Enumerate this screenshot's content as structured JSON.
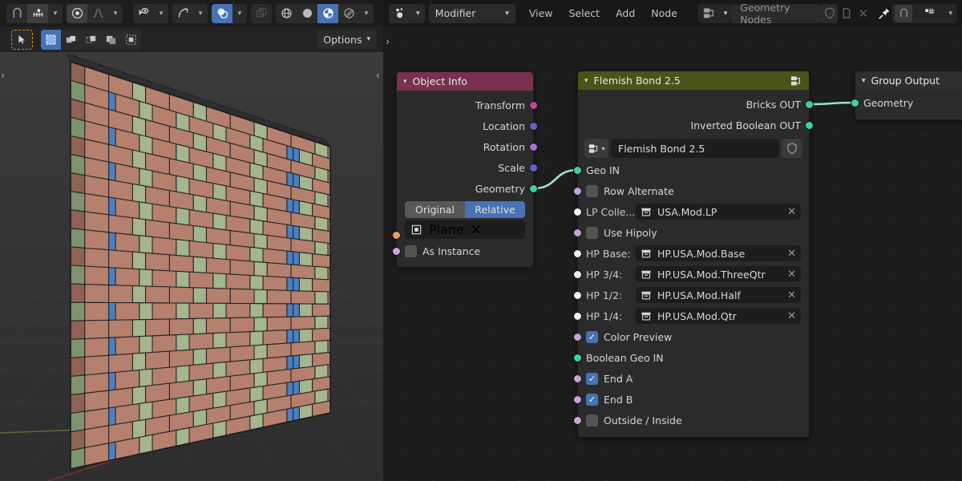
{
  "viewport": {
    "toolbar_row1": [
      {
        "name": "snap-magnet-icon",
        "state": "off"
      },
      {
        "name": "snap-increment-icon",
        "state": "off"
      },
      {
        "name": "snap-dropdown-chevron",
        "state": "off"
      },
      {
        "name": "proportional-edit-icon",
        "state": "on"
      },
      {
        "name": "proportional-falloff-icon",
        "state": "dim"
      },
      {
        "name": "falloff-dropdown-chevron",
        "state": "off"
      },
      {
        "name": "visibility-eye-icon",
        "state": "off"
      },
      {
        "name": "visibility-dropdown-chevron",
        "state": "off"
      },
      {
        "name": "gizmo-icon",
        "state": "off"
      },
      {
        "name": "gizmo-dropdown-chevron",
        "state": "dim"
      },
      {
        "name": "overlays-icon",
        "state": "active"
      },
      {
        "name": "overlays-dropdown-chevron",
        "state": "off"
      },
      {
        "name": "xray-toggle-icon",
        "state": "dim"
      },
      {
        "name": "shading-wireframe-icon",
        "state": "off"
      },
      {
        "name": "shading-solid-icon",
        "state": "off"
      },
      {
        "name": "shading-material-icon",
        "state": "active"
      },
      {
        "name": "shading-rendered-icon",
        "state": "off"
      },
      {
        "name": "shading-dropdown-chevron",
        "state": "off"
      }
    ],
    "select_modes": [
      "tweak",
      "box",
      "circle",
      "lasso"
    ],
    "options_label": "Options",
    "expand_arrow_left": "<",
    "expand_arrow_region": ">"
  },
  "node_editor": {
    "header": {
      "editor_type_icon": "geometry-nodes-editor-icon",
      "mode_select": "Modifier",
      "menus": [
        "View",
        "Select",
        "Add",
        "Node"
      ],
      "datablock_icon": "node-group-icon",
      "datablock_name": "Geometry Nodes",
      "shield_icon": "fake-user-shield-icon",
      "duplicate_icon": "new-copy-icon",
      "unlink_icon": "unlink-x-icon",
      "pin_icon": "pin-icon",
      "snap_icon": "snap-magnet-icon",
      "snap_target_icon": "snap-grid-icon",
      "snap_chevron": "chevron-down-icon"
    },
    "nodes": [
      {
        "id": "object-info",
        "title": "Object Info",
        "header_color": "#7a3050",
        "outputs": [
          {
            "label": "Transform",
            "color": "#c4478f"
          },
          {
            "label": "Location",
            "color": "#6363c7"
          },
          {
            "label": "Rotation",
            "color": "#a86fd4"
          },
          {
            "label": "Scale",
            "color": "#6363c7"
          },
          {
            "label": "Geometry",
            "color": "#3ed2a0"
          }
        ],
        "transform_space": {
          "options": [
            "Original",
            "Relative"
          ],
          "selected": "Relative"
        },
        "object_field": {
          "icon": "object-plane-icon",
          "value": "Plane",
          "clear": "✕",
          "socket_color": "#ed9e5c"
        },
        "as_instance": {
          "label": "As Instance",
          "checked": false,
          "socket_color": "#c7a2dd"
        }
      },
      {
        "id": "flemish-bond",
        "title": "Flemish Bond 2.5",
        "header_color": "#4b5318",
        "header_icon": "node-group-icon",
        "outputs": [
          {
            "label": "Bricks OUT",
            "color": "#3ed2a0"
          },
          {
            "label": "Inverted Boolean OUT",
            "color": "#3ed2a0"
          }
        ],
        "id_block": {
          "icon": "node-group-icon",
          "chevron": "chevron-down-icon",
          "name": "Flemish Bond 2.5",
          "shield": "fake-user-shield-icon"
        },
        "inputs": [
          {
            "type": "label",
            "label": "Geo IN",
            "socket_color": "#3ed2a0"
          },
          {
            "type": "check",
            "label": "Row Alternate",
            "checked": false,
            "socket_color": "#c7a2dd"
          },
          {
            "type": "field",
            "prefix": "LP Colle...",
            "icon": "collection-icon",
            "value": "USA.Mod.LP",
            "clear": "✕",
            "socket_color": "#f0f0f0"
          },
          {
            "type": "check",
            "label": "Use Hipoly",
            "checked": false,
            "socket_color": "#c7a2dd"
          },
          {
            "type": "field",
            "prefix": "HP Base:",
            "icon": "collection-icon",
            "value": "HP.USA.Mod.Base",
            "clear": "✕",
            "socket_color": "#f0f0f0"
          },
          {
            "type": "field",
            "prefix": "HP 3/4:",
            "icon": "collection-icon",
            "value": "HP.USA.Mod.ThreeQtr",
            "clear": "✕",
            "socket_color": "#f0f0f0"
          },
          {
            "type": "field",
            "prefix": "HP 1/2:",
            "icon": "collection-icon",
            "value": "HP.USA.Mod.Half",
            "clear": "✕",
            "socket_color": "#f0f0f0"
          },
          {
            "type": "field",
            "prefix": "HP 1/4:",
            "icon": "collection-icon",
            "value": "HP.USA.Mod.Qtr",
            "clear": "✕",
            "socket_color": "#f0f0f0"
          },
          {
            "type": "check",
            "label": "Color Preview",
            "checked": true,
            "socket_color": "#c7a2dd"
          },
          {
            "type": "label",
            "label": "Boolean Geo IN",
            "socket_color": "#3ed2a0"
          },
          {
            "type": "check",
            "label": "End A",
            "checked": true,
            "socket_color": "#c7a2dd"
          },
          {
            "type": "check",
            "label": "End B",
            "checked": true,
            "socket_color": "#c7a2dd"
          },
          {
            "type": "check",
            "label": "Outside / Inside",
            "checked": false,
            "socket_color": "#c7a2dd"
          }
        ]
      },
      {
        "id": "group-output",
        "title": "Group Output",
        "header_color": "#2b2b2b",
        "inputs": [
          {
            "label": "Geometry",
            "color": "#3ed2a0"
          }
        ]
      }
    ],
    "wire_color": "#9fe3c9"
  },
  "scene": {
    "description": "Flemish bond brick wall in perspective",
    "brick_colors": {
      "stretcher": "#b5806e",
      "header": "#a5b58e",
      "accent": "#4a7fc1",
      "side_stretcher": "#8e6254",
      "side_header": "#7f9270",
      "top_face": "#2e2e2e",
      "outline": "#232323"
    },
    "grid_color": "#3f3f3f",
    "axis_y_color": "#5a6b35",
    "axis_x_color": "#7a3340",
    "background_top": "#393939",
    "background_bottom": "#2e2e2e",
    "rows": 22,
    "cols": 14
  }
}
